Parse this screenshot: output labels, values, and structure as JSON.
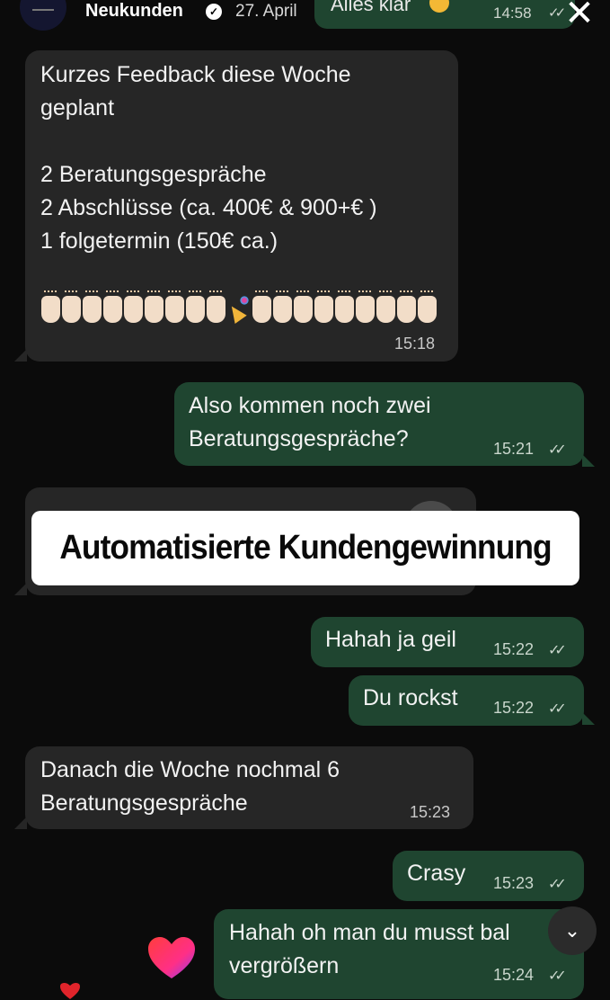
{
  "header": {
    "name": "Neukunden",
    "date": "27. April",
    "verified_icon": "verified-badge-icon",
    "close_icon": "close-icon"
  },
  "top_message": {
    "text": "Alles klar",
    "emoji": "ok-hand-emoji",
    "time": "14:58"
  },
  "messages": [
    {
      "direction": "incoming",
      "text": "Kurzes Feedback diese Woche\ngeplant\n\n2 Beratungsgespräche\n2 Abschlüsse (ca. 400€ & 900+€ )\n1 folgetermin (150€ ca.)",
      "emoji_row": [
        "raising-hands",
        "raising-hands",
        "raising-hands",
        "raising-hands",
        "raising-hands",
        "raising-hands",
        "raising-hands",
        "raising-hands",
        "raising-hands",
        "party-popper",
        "raising-hands",
        "raising-hands",
        "raising-hands",
        "raising-hands",
        "raising-hands",
        "raising-hands",
        "raising-hands",
        "raising-hands",
        "raising-hands"
      ],
      "time": "15:18"
    },
    {
      "direction": "outgoing",
      "text": "Also kommen noch zwei\nBeratungsgespräche?",
      "time": "15:21"
    },
    {
      "direction": "incoming",
      "text": "",
      "covered": true
    },
    {
      "direction": "outgoing",
      "text": "Hahah ja geil",
      "time": "15:22"
    },
    {
      "direction": "outgoing",
      "text": "Du rockst",
      "time": "15:22"
    },
    {
      "direction": "incoming",
      "text": "Danach die Woche nochmal 6\nBeratungsgespräche",
      "time": "15:23"
    },
    {
      "direction": "outgoing",
      "text": "Crasy",
      "time": "15:23"
    },
    {
      "direction": "outgoing",
      "text": "Hahah oh man du musst bal\nvergrößern",
      "time": "15:24"
    }
  ],
  "overlay": {
    "banner_text": "Automatisierte Kundengewinnung"
  },
  "controls": {
    "scroll_down_icon": "chevron-down-icon"
  },
  "decorations": {
    "reaction_icon": "heart-icon"
  },
  "colors": {
    "background": "#0b0b0b",
    "incoming_bubble": "#262626",
    "outgoing_bubble": "#1f4530",
    "banner": "#ffffff"
  }
}
